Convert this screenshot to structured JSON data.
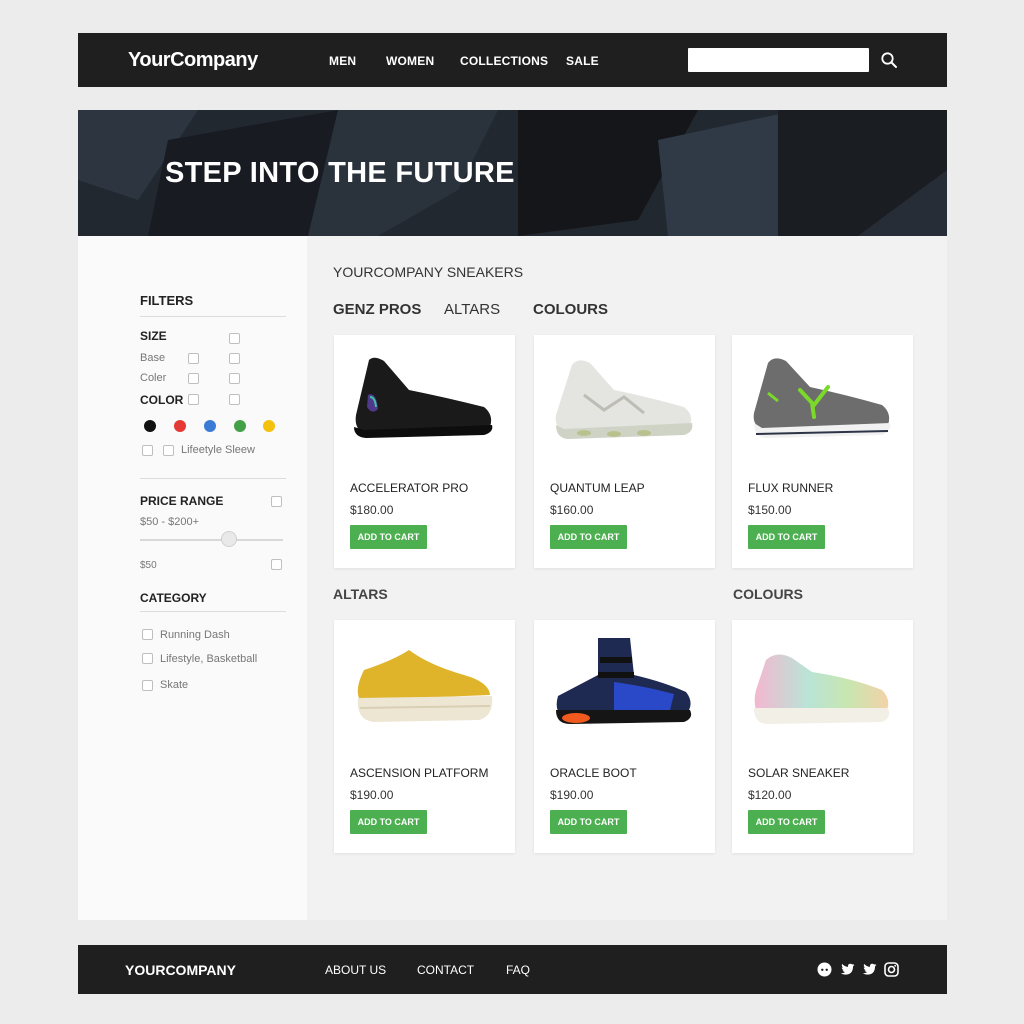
{
  "header": {
    "logo": "YourCompany",
    "nav": [
      "MEN",
      "WOMEN",
      "COLLECTIONS",
      "SALE"
    ],
    "search_placeholder": ""
  },
  "hero": {
    "title": "STEP INTO THE FUTURE"
  },
  "sidebar": {
    "filters_title": "FILTERS",
    "size_title": "SIZE",
    "size_options": [
      "Base",
      "Coler"
    ],
    "color_title": "COLOR",
    "colors": [
      "#111111",
      "#e53935",
      "#3a7bd5",
      "#43a047",
      "#f4c20d"
    ],
    "lifestyle_label": "Lifeetyle Sleew",
    "price_title": "PRICE RANGE",
    "price_range": "$50 - $200+",
    "price_min": "$50",
    "slider_value_fraction": 0.6,
    "category_title": "CATEGORY",
    "categories": [
      "Running Dash",
      "Lifestyle, Basketball",
      "Skate"
    ]
  },
  "content": {
    "title": "YOURCOMPANY SNEAKERS",
    "tabs": [
      "GENZ PROS",
      "ALTARS",
      "COLOURS"
    ],
    "sections": [
      "ALTARS",
      "COLOURS"
    ],
    "button_label": "ADD TO CART",
    "products": [
      {
        "name": "ACCELERATOR PRO",
        "price": "$180.00"
      },
      {
        "name": "QUANTUM LEAP",
        "price": "$160.00"
      },
      {
        "name": "FLUX RUNNER",
        "price": "$150.00"
      },
      {
        "name": "ASCENSION PLATFORM",
        "price": "$190.00"
      },
      {
        "name": "ORACLE BOOT",
        "price": "$190.00"
      },
      {
        "name": "SOLAR SNEAKER",
        "price": "$120.00"
      }
    ]
  },
  "footer": {
    "logo": "YOURCOMPANY",
    "links": [
      "ABOUT US",
      "CONTACT",
      "FAQ"
    ],
    "social_icons": [
      "discord-icon",
      "twitter-icon",
      "twitter-icon",
      "instagram-icon"
    ]
  },
  "colors": {
    "accent": "#4caf50",
    "dark": "#1f1f1f"
  }
}
